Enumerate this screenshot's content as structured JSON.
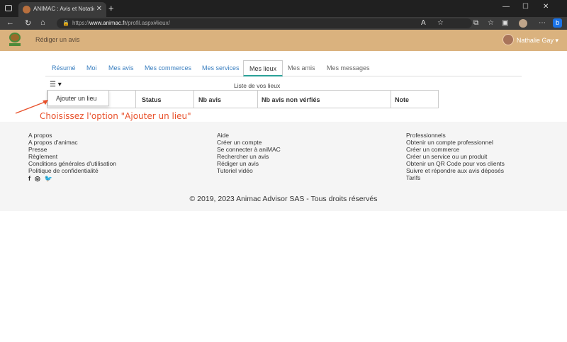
{
  "browser": {
    "tab_title": "ANIMAC : Avis et Notations sur l",
    "tab_close": "✕",
    "new_tab": "+",
    "url_prefix": "https://",
    "url_domain": "www.animac.fr",
    "url_path": "/profil.aspx#lieux/",
    "window_controls": [
      "—",
      "☐",
      "✕"
    ],
    "toolbar_icons": [
      "read-aloud-icon",
      "favorite-star-icon",
      "extensions-icon",
      "favorites-icon",
      "collections-icon",
      "profile-icon",
      "more-icon",
      "bing-icon"
    ]
  },
  "header": {
    "write_review": "Rédiger un avis",
    "user_name": "Nathalie Gay",
    "user_caret": "▾"
  },
  "tabs": [
    {
      "label": "Résumé"
    },
    {
      "label": "Moi"
    },
    {
      "label": "Mes avis"
    },
    {
      "label": "Mes commerces"
    },
    {
      "label": "Mes services"
    },
    {
      "label": "Mes lieux"
    },
    {
      "label": "Mes amis"
    },
    {
      "label": "Mes messages"
    }
  ],
  "list": {
    "title": "Liste de vos lieux",
    "menu_icon": "☰ ▾",
    "columns": [
      "Status",
      "Nb avis",
      "Nb avis non vérfiés",
      "Note"
    ],
    "dropdown_item": "Ajouter un lieu"
  },
  "annotation": {
    "text": "Choisissez l'option \"Ajouter un lieu\"",
    "color": "#e8502a"
  },
  "footer": {
    "col1": [
      "A propos",
      "A propos d'animac",
      "Presse",
      "Règlement",
      "Conditions générales d'utilisation",
      "Politique de confidentialité"
    ],
    "social": [
      "f",
      "◎",
      "🐦"
    ],
    "col2": [
      "Aide",
      "Créer un compte",
      "Se connecter à aniMAC",
      "Rechercher un avis",
      "Rédiger un avis",
      "Tutoriel vidéo"
    ],
    "col3": [
      "Professionnels",
      "Obtenir un compte professionnel",
      "Créer un commerce",
      "Créer un service ou un produit",
      "Obtenir un QR Code pour vos clients",
      "Suivre et répondre aux avis déposés",
      "Tarifs"
    ],
    "copyright": "© 2019, 2023 Animac Advisor SAS - Tous droits réservés"
  },
  "colors": {
    "header_bg": "#dab27e",
    "link": "#3a7fc0",
    "active_underline": "#2aa198"
  }
}
